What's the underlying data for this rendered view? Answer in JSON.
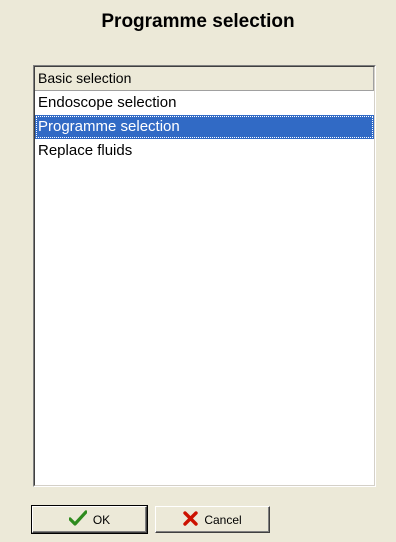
{
  "dialog": {
    "title": "Programme selection"
  },
  "list": {
    "header": "Basic selection",
    "items": [
      {
        "label": "Endoscope selection",
        "selected": false
      },
      {
        "label": "Programme selection",
        "selected": true
      },
      {
        "label": "Replace fluids",
        "selected": false
      }
    ]
  },
  "buttons": {
    "ok_label": "OK",
    "ok_icon": "checkmark-icon",
    "cancel_label": "Cancel",
    "cancel_icon": "x-cross-icon"
  },
  "colors": {
    "background": "#ece9d8",
    "selection": "#316ac5",
    "ok_icon": "#2e8b1e",
    "cancel_icon": "#cc1100"
  }
}
